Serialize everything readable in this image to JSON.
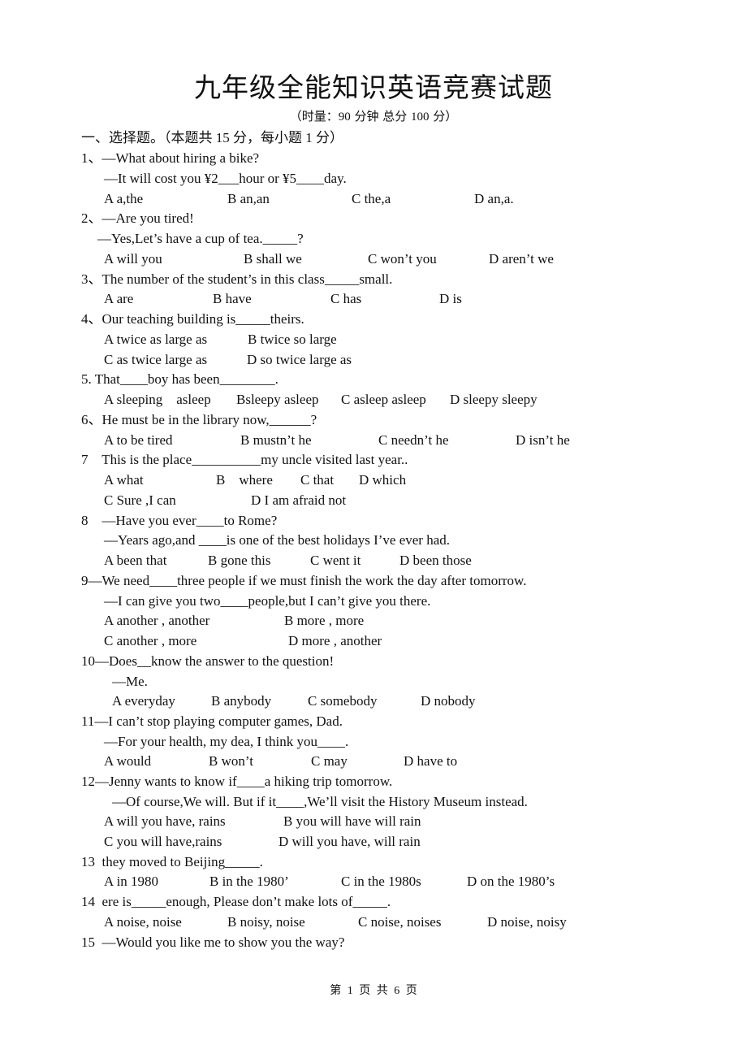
{
  "doc": {
    "title": "九年级全能知识英语竞赛试题",
    "subtitle": "（时量：90 分钟      总分 100 分）",
    "section": "一、选择题。（本题共 15 分，每小题 1 分）",
    "footer": "第 1 页 共 6 页"
  },
  "q": {
    "q1": {
      "stem": "1、—What about hiring a bike?",
      "reply": "—It will cost you ¥2___hour or ¥5____day.",
      "options": [
        "A a,the",
        "B an,an",
        "C the,a",
        "D an,a."
      ]
    },
    "q2": {
      "stem": "2、—Are you tired!",
      "reply": "—Yes,Let’s have a cup of tea._____?",
      "options": [
        "A will you",
        "B shall we",
        "C won’t you",
        "D aren’t we"
      ]
    },
    "q3": {
      "stem": "3、The number of the student’s in this class_____small.",
      "options": [
        "A are",
        "B have",
        "C has",
        "D is"
      ]
    },
    "q4": {
      "stem": "4、Our teaching building is_____theirs.",
      "options": [
        "A twice as large as",
        "B twice so large",
        "C as twice large as",
        "D so twice large as"
      ]
    },
    "q5": {
      "stem": "5. That____boy has been________.",
      "options": [
        "A sleeping    asleep",
        "Bsleepy asleep",
        "C asleep asleep",
        "D sleepy sleepy"
      ]
    },
    "q6": {
      "stem": "6、He must be in the library now,______?",
      "options": [
        "A to be tired",
        "B mustn’t he",
        "C needn’t he",
        "D isn’t he"
      ]
    },
    "q7": {
      "stem": "7    This is the place__________my uncle visited last year..",
      "options": [
        "A what",
        "B    where",
        "C that",
        "D which",
        "C Sure ,I can",
        "D I am afraid not"
      ]
    },
    "q8": {
      "stem": "8    —Have you ever____to Rome?",
      "reply": "—Years ago,and ____is one of the best holidays I’ve ever had.",
      "options": [
        "A been that",
        "B gone this",
        "C went it",
        "D been those"
      ]
    },
    "q9": {
      "stem": "9—We need____three people if we must finish the work the day after tomorrow.",
      "reply": "—I can give you two____people,but I can’t give you there.",
      "options": [
        "A another , another",
        "B more , more",
        "C another , more",
        "D more , another"
      ]
    },
    "q10": {
      "stem": "10—Does__know the answer to the question!",
      "reply": "—Me.",
      "options": [
        "A everyday",
        "B anybody",
        "C somebody",
        "D nobody"
      ]
    },
    "q11": {
      "stem": "11—I can’t stop playing computer games, Dad.",
      "reply": "—For your health, my dea, I think you____.",
      "options": [
        "A would",
        "B won’t",
        "C may",
        "D have to"
      ]
    },
    "q12": {
      "stem": "12—Jenny wants to know if____a hiking trip tomorrow.",
      "reply": "—Of course,We will. But if it____,We’ll visit the History Museum instead.",
      "options": [
        "A will you have, rains",
        "B you will have will rain",
        "C you will have,rains",
        "D will you have, will rain"
      ]
    },
    "q13": {
      "stem": "13  they moved to Beijing_____.",
      "options": [
        "A in 1980",
        "B in the 1980’",
        "C in the 1980s",
        "D on the 1980’s"
      ]
    },
    "q14": {
      "stem": "14  ere is_____enough, Please don’t make lots of_____.",
      "options": [
        "A noise, noise",
        "B noisy, noise",
        "C noise, noises",
        "D noise, noisy"
      ]
    },
    "q15": {
      "stem": "15  —Would you like me to show you the way?"
    }
  }
}
